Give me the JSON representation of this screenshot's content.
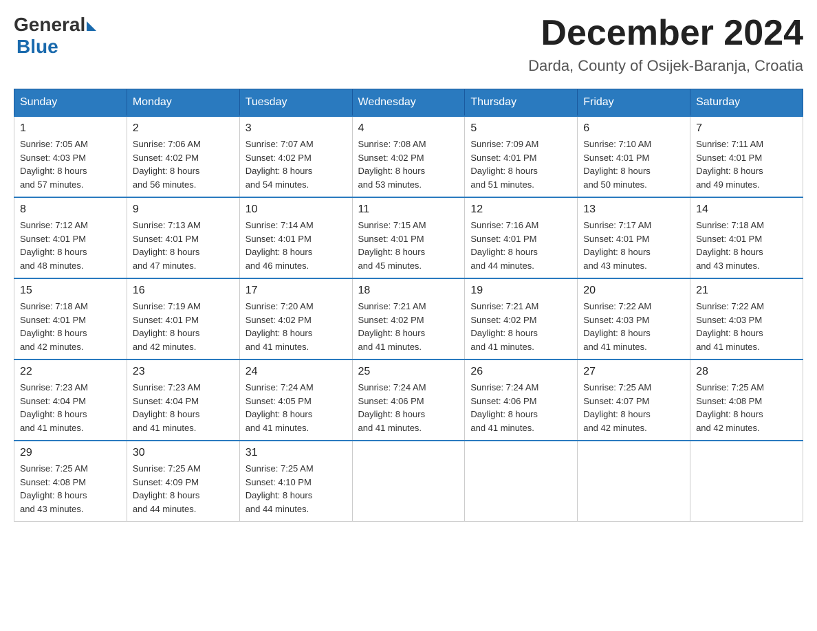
{
  "logo": {
    "general": "General",
    "blue": "Blue"
  },
  "header": {
    "month_year": "December 2024",
    "location": "Darda, County of Osijek-Baranja, Croatia"
  },
  "weekdays": [
    "Sunday",
    "Monday",
    "Tuesday",
    "Wednesday",
    "Thursday",
    "Friday",
    "Saturday"
  ],
  "weeks": [
    [
      {
        "day": "1",
        "sunrise": "7:05 AM",
        "sunset": "4:03 PM",
        "daylight": "8 hours and 57 minutes."
      },
      {
        "day": "2",
        "sunrise": "7:06 AM",
        "sunset": "4:02 PM",
        "daylight": "8 hours and 56 minutes."
      },
      {
        "day": "3",
        "sunrise": "7:07 AM",
        "sunset": "4:02 PM",
        "daylight": "8 hours and 54 minutes."
      },
      {
        "day": "4",
        "sunrise": "7:08 AM",
        "sunset": "4:02 PM",
        "daylight": "8 hours and 53 minutes."
      },
      {
        "day": "5",
        "sunrise": "7:09 AM",
        "sunset": "4:01 PM",
        "daylight": "8 hours and 51 minutes."
      },
      {
        "day": "6",
        "sunrise": "7:10 AM",
        "sunset": "4:01 PM",
        "daylight": "8 hours and 50 minutes."
      },
      {
        "day": "7",
        "sunrise": "7:11 AM",
        "sunset": "4:01 PM",
        "daylight": "8 hours and 49 minutes."
      }
    ],
    [
      {
        "day": "8",
        "sunrise": "7:12 AM",
        "sunset": "4:01 PM",
        "daylight": "8 hours and 48 minutes."
      },
      {
        "day": "9",
        "sunrise": "7:13 AM",
        "sunset": "4:01 PM",
        "daylight": "8 hours and 47 minutes."
      },
      {
        "day": "10",
        "sunrise": "7:14 AM",
        "sunset": "4:01 PM",
        "daylight": "8 hours and 46 minutes."
      },
      {
        "day": "11",
        "sunrise": "7:15 AM",
        "sunset": "4:01 PM",
        "daylight": "8 hours and 45 minutes."
      },
      {
        "day": "12",
        "sunrise": "7:16 AM",
        "sunset": "4:01 PM",
        "daylight": "8 hours and 44 minutes."
      },
      {
        "day": "13",
        "sunrise": "7:17 AM",
        "sunset": "4:01 PM",
        "daylight": "8 hours and 43 minutes."
      },
      {
        "day": "14",
        "sunrise": "7:18 AM",
        "sunset": "4:01 PM",
        "daylight": "8 hours and 43 minutes."
      }
    ],
    [
      {
        "day": "15",
        "sunrise": "7:18 AM",
        "sunset": "4:01 PM",
        "daylight": "8 hours and 42 minutes."
      },
      {
        "day": "16",
        "sunrise": "7:19 AM",
        "sunset": "4:01 PM",
        "daylight": "8 hours and 42 minutes."
      },
      {
        "day": "17",
        "sunrise": "7:20 AM",
        "sunset": "4:02 PM",
        "daylight": "8 hours and 41 minutes."
      },
      {
        "day": "18",
        "sunrise": "7:21 AM",
        "sunset": "4:02 PM",
        "daylight": "8 hours and 41 minutes."
      },
      {
        "day": "19",
        "sunrise": "7:21 AM",
        "sunset": "4:02 PM",
        "daylight": "8 hours and 41 minutes."
      },
      {
        "day": "20",
        "sunrise": "7:22 AM",
        "sunset": "4:03 PM",
        "daylight": "8 hours and 41 minutes."
      },
      {
        "day": "21",
        "sunrise": "7:22 AM",
        "sunset": "4:03 PM",
        "daylight": "8 hours and 41 minutes."
      }
    ],
    [
      {
        "day": "22",
        "sunrise": "7:23 AM",
        "sunset": "4:04 PM",
        "daylight": "8 hours and 41 minutes."
      },
      {
        "day": "23",
        "sunrise": "7:23 AM",
        "sunset": "4:04 PM",
        "daylight": "8 hours and 41 minutes."
      },
      {
        "day": "24",
        "sunrise": "7:24 AM",
        "sunset": "4:05 PM",
        "daylight": "8 hours and 41 minutes."
      },
      {
        "day": "25",
        "sunrise": "7:24 AM",
        "sunset": "4:06 PM",
        "daylight": "8 hours and 41 minutes."
      },
      {
        "day": "26",
        "sunrise": "7:24 AM",
        "sunset": "4:06 PM",
        "daylight": "8 hours and 41 minutes."
      },
      {
        "day": "27",
        "sunrise": "7:25 AM",
        "sunset": "4:07 PM",
        "daylight": "8 hours and 42 minutes."
      },
      {
        "day": "28",
        "sunrise": "7:25 AM",
        "sunset": "4:08 PM",
        "daylight": "8 hours and 42 minutes."
      }
    ],
    [
      {
        "day": "29",
        "sunrise": "7:25 AM",
        "sunset": "4:08 PM",
        "daylight": "8 hours and 43 minutes."
      },
      {
        "day": "30",
        "sunrise": "7:25 AM",
        "sunset": "4:09 PM",
        "daylight": "8 hours and 44 minutes."
      },
      {
        "day": "31",
        "sunrise": "7:25 AM",
        "sunset": "4:10 PM",
        "daylight": "8 hours and 44 minutes."
      },
      null,
      null,
      null,
      null
    ]
  ],
  "labels": {
    "sunrise": "Sunrise:",
    "sunset": "Sunset:",
    "daylight": "Daylight:"
  }
}
